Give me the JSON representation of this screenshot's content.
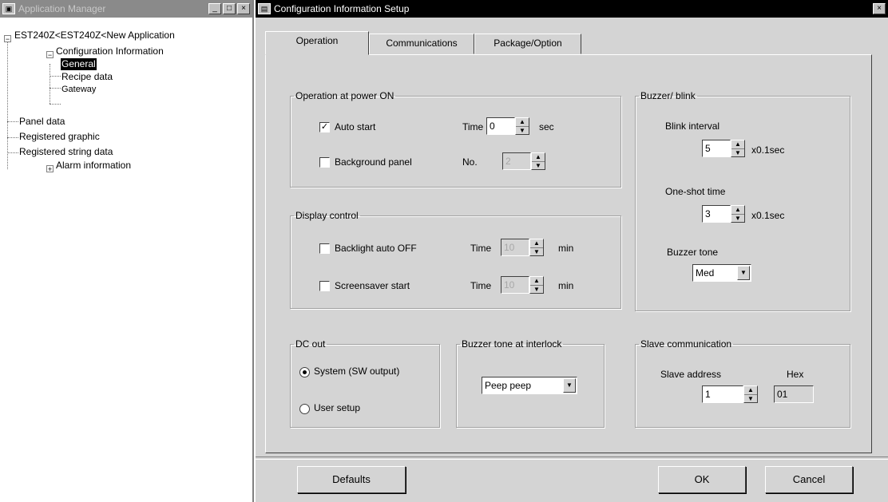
{
  "app_manager": {
    "title": "Application Manager",
    "window_buttons": [
      "_",
      "□",
      "×"
    ],
    "tree": {
      "root": "EST240Z<EST240Z<New Application",
      "config_info": "Configuration Information",
      "general": "General",
      "recipe": "Recipe data",
      "gateway": "Gateway",
      "panel": "Panel data",
      "reg_graphic": "Registered graphic",
      "reg_string": "Registered string data",
      "alarm": "Alarm information"
    }
  },
  "dialog": {
    "title": "Configuration Information Setup",
    "close": "×",
    "tabs": [
      "Operation",
      "Communications",
      "Package/Option"
    ],
    "power_on": {
      "legend": "Operation at power ON",
      "auto_start": "Auto start",
      "auto_start_checked": true,
      "time_label": "Time",
      "time_value": "0",
      "sec": "sec",
      "bg_panel": "Background panel",
      "bg_panel_checked": false,
      "no_label": "No.",
      "no_value": "2"
    },
    "display": {
      "legend": "Display control",
      "backlight": "Backlight auto OFF",
      "backlight_checked": false,
      "backlight_time_label": "Time",
      "backlight_value": "10",
      "backlight_unit": "min",
      "saver": "Screensaver start",
      "saver_checked": false,
      "saver_time_label": "Time",
      "saver_value": "10",
      "saver_unit": "min"
    },
    "buzzer_blink": {
      "legend": "Buzzer/ blink",
      "blink_label": "Blink interval",
      "blink_value": "5",
      "blink_unit": "x0.1sec",
      "oneshot_label": "One-shot time",
      "oneshot_value": "3",
      "oneshot_unit": "x0.1sec",
      "tone_label": "Buzzer tone",
      "tone_value": "Med"
    },
    "dc_out": {
      "legend": "DC out",
      "system": "System (SW output)",
      "user": "User setup",
      "selected": "system"
    },
    "interlock": {
      "legend": "Buzzer tone at interlock",
      "value": "Peep peep"
    },
    "slave": {
      "legend": "Slave communication",
      "addr_label": "Slave address",
      "hex_label": "Hex",
      "addr_value": "1",
      "hex_value": "01"
    },
    "buttons": {
      "defaults": "Defaults",
      "ok": "OK",
      "cancel": "Cancel"
    }
  }
}
